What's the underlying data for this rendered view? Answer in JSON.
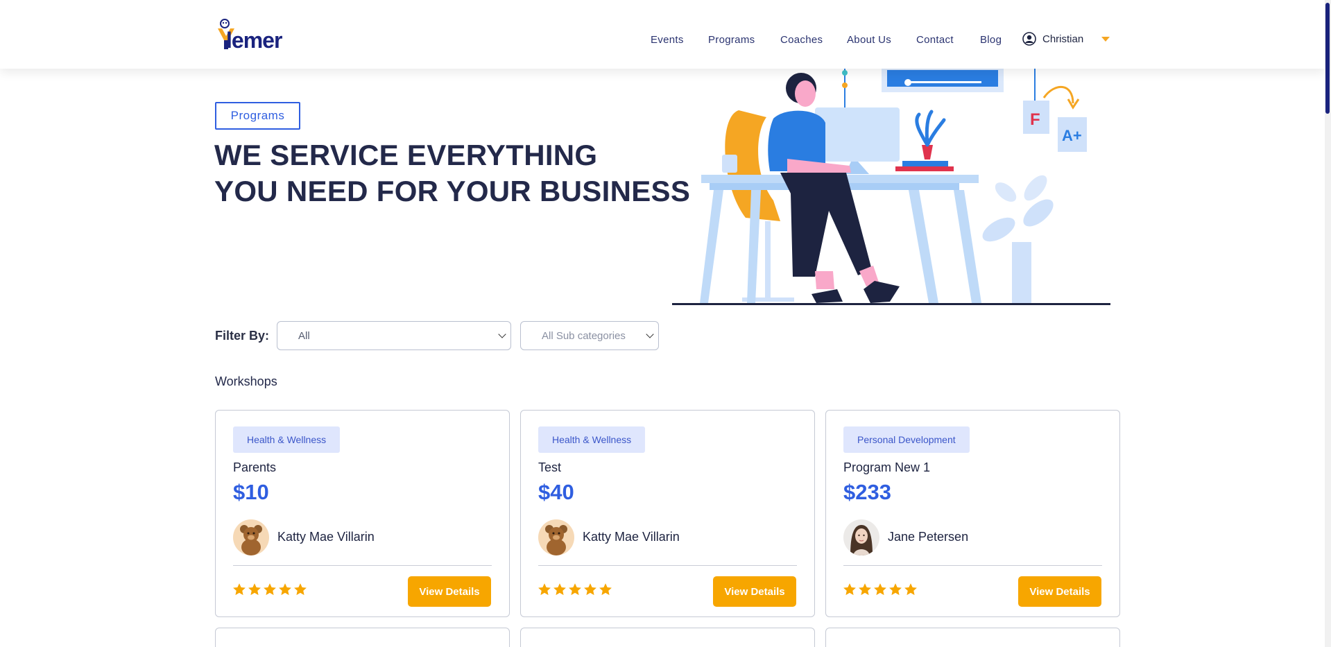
{
  "header": {
    "logo_text": "lemer",
    "nav": [
      "Events",
      "Programs",
      "Coaches",
      "About Us",
      "Contact",
      "Blog"
    ],
    "user_name": "Christian"
  },
  "hero": {
    "badge": "Programs",
    "title_line1": "WE SERVICE EVERYTHING",
    "title_line2": "YOU NEED FOR YOUR BUSINESS",
    "grade_from": "F",
    "grade_to": "A+"
  },
  "filter": {
    "label": "Filter By:",
    "category_selected": "All",
    "subcategory_selected": "All Sub categories"
  },
  "section_title": "Workshops",
  "cards": [
    {
      "tag": "Health & Wellness",
      "title": "Parents",
      "price": "$10",
      "coach": "Katty Mae Villarin",
      "avatar": "teddy-bear",
      "rating": 5,
      "button": "View Details"
    },
    {
      "tag": "Health & Wellness",
      "title": "Test",
      "price": "$40",
      "coach": "Katty Mae Villarin",
      "avatar": "teddy-bear",
      "rating": 5,
      "button": "View Details"
    },
    {
      "tag": "Personal Development",
      "title": "Program New 1",
      "price": "$233",
      "coach": "Jane Petersen",
      "avatar": "woman-portrait",
      "rating": 5,
      "button": "View Details"
    }
  ],
  "colors": {
    "brand_navy": "#1a237e",
    "accent_blue": "#2f5ee0",
    "accent_orange": "#f7a600",
    "tag_bg": "#dfe6fd"
  }
}
